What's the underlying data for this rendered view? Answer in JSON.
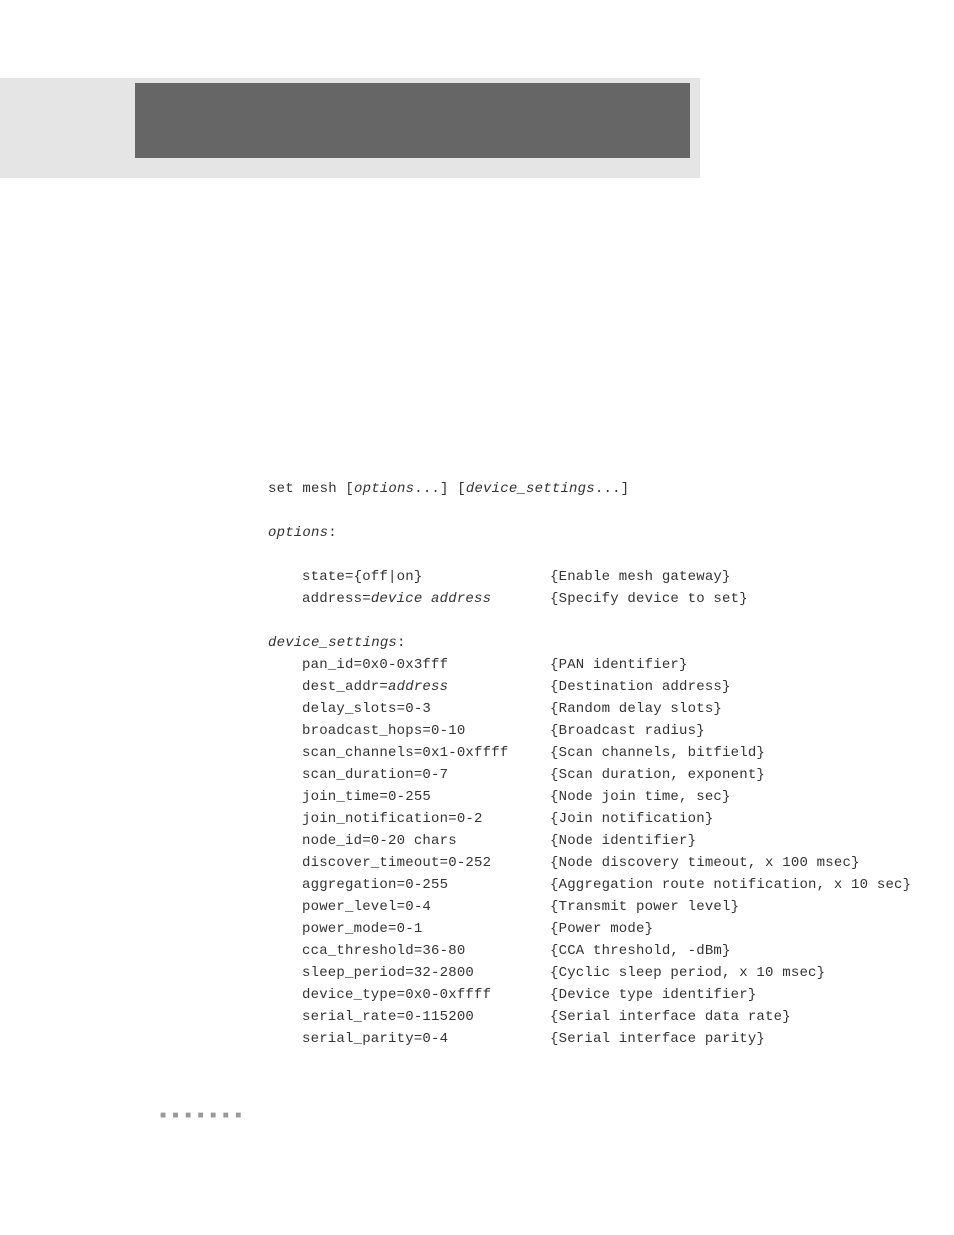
{
  "cmd": {
    "prefix": "set mesh [",
    "arg1": "options",
    "mid": "...] [",
    "arg2": "device_settings",
    "suffix": "...]"
  },
  "sections": {
    "options_label": "options",
    "device_label": "device_settings"
  },
  "options": [
    {
      "key_prefix": "state={off|on}",
      "key_italic": "",
      "desc": "{Enable mesh gateway}"
    },
    {
      "key_prefix": "address=",
      "key_italic": "device address",
      "desc": "{Specify device to set}"
    }
  ],
  "device_settings": [
    {
      "key_prefix": "pan_id=0x0-0x3fff",
      "key_italic": "",
      "desc": "{PAN identifier}"
    },
    {
      "key_prefix": "dest_addr=",
      "key_italic": "address",
      "desc": "{Destination address}"
    },
    {
      "key_prefix": "delay_slots=0-3",
      "key_italic": "",
      "desc": "{Random delay slots}"
    },
    {
      "key_prefix": "broadcast_hops=0-10",
      "key_italic": "",
      "desc": "{Broadcast radius}"
    },
    {
      "key_prefix": "scan_channels=0x1-0xffff",
      "key_italic": "",
      "desc": "{Scan channels, bitfield}"
    },
    {
      "key_prefix": "scan_duration=0-7",
      "key_italic": "",
      "desc": "{Scan duration, exponent}"
    },
    {
      "key_prefix": "join_time=0-255",
      "key_italic": "",
      "desc": "{Node join time, sec}"
    },
    {
      "key_prefix": "join_notification=0-2",
      "key_italic": "",
      "desc": "{Join notification}"
    },
    {
      "key_prefix": "node_id=0-20 chars",
      "key_italic": "",
      "desc": "{Node identifier}"
    },
    {
      "key_prefix": "discover_timeout=0-252",
      "key_italic": "",
      "desc": "{Node discovery timeout, x 100 msec}"
    },
    {
      "key_prefix": "aggregation=0-255",
      "key_italic": "",
      "desc": "{Aggregation route notification, x 10 sec}"
    },
    {
      "key_prefix": "power_level=0-4",
      "key_italic": "",
      "desc": "{Transmit power level}"
    },
    {
      "key_prefix": "power_mode=0-1",
      "key_italic": "",
      "desc": "{Power mode}"
    },
    {
      "key_prefix": "cca_threshold=36-80",
      "key_italic": "",
      "desc": "{CCA threshold, -dBm}"
    },
    {
      "key_prefix": "sleep_period=32-2800",
      "key_italic": "",
      "desc": "{Cyclic sleep period, x 10 msec}"
    },
    {
      "key_prefix": "device_type=0x0-0xffff",
      "key_italic": "",
      "desc": "{Device type identifier}"
    },
    {
      "key_prefix": "serial_rate=0-115200",
      "key_italic": "",
      "desc": "{Serial interface data rate}"
    },
    {
      "key_prefix": "serial_parity=0-4",
      "key_italic": "",
      "desc": "{Serial interface parity}"
    }
  ],
  "footer_dots": "■ ■ ■ ■ ■ ■ ■"
}
